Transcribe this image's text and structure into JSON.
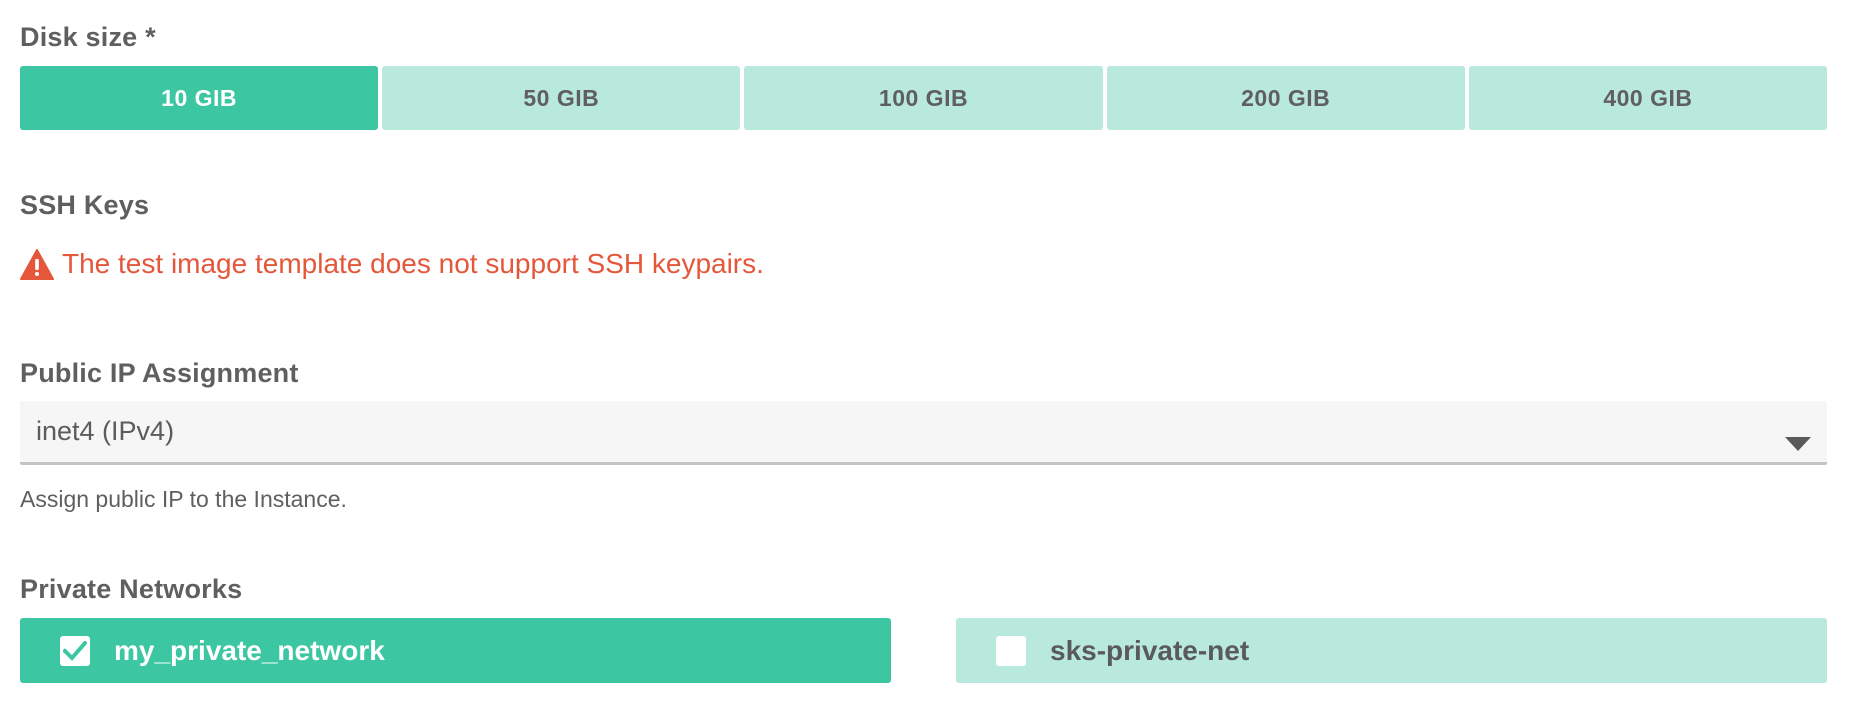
{
  "disk": {
    "label": "Disk size *",
    "options": [
      "10 GIB",
      "50 GIB",
      "100 GIB",
      "200 GIB",
      "400 GIB"
    ],
    "selected": "10 GIB"
  },
  "ssh": {
    "label": "SSH Keys",
    "warning_icon": "warning-triangle-icon",
    "warning": "The test image template does not support SSH keypairs."
  },
  "public_ip": {
    "label": "Public IP Assignment",
    "selected_value": "inet4 (IPv4)",
    "dropdown_icon": "caret-down-icon",
    "help": "Assign public IP to the Instance."
  },
  "private_networks": {
    "label": "Private Networks",
    "items": [
      {
        "label": "my_private_network",
        "checked": true
      },
      {
        "label": "sks-private-net",
        "checked": false
      }
    ]
  },
  "colors": {
    "accent": "#3cc6a2",
    "accent_light": "#b8e9dc",
    "warning": "#e5573a",
    "text": "#5f5f5f"
  }
}
